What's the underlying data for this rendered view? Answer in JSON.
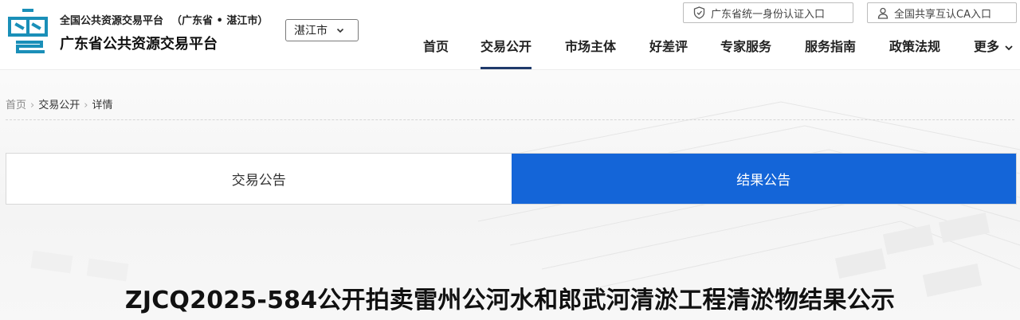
{
  "header": {
    "subtitle": "全国公共资源交易平台",
    "region": "（广东省 • 湛江市）",
    "title": "广东省公共资源交易平台",
    "city_select": "湛江市",
    "identity_link": "广东省统一身份认证入口",
    "ca_link": "全国共享互认CA入口"
  },
  "nav": {
    "items": [
      "首页",
      "交易公开",
      "市场主体",
      "好差评",
      "专家服务",
      "服务指南",
      "政策法规",
      "更多"
    ],
    "active": "交易公开"
  },
  "breadcrumb": [
    "首页",
    "交易公开",
    "详情"
  ],
  "tabs": {
    "items": [
      "交易公告",
      "结果公告"
    ],
    "active": "结果公告"
  },
  "main": {
    "title": "ZJCQ2025-584公开拍卖雷州公河水和郎武河清淤工程清淤物结果公示"
  },
  "colors": {
    "accent": "#1465d8",
    "logo": "#1a8fb8",
    "nav_underline": "#1f3a6b"
  }
}
